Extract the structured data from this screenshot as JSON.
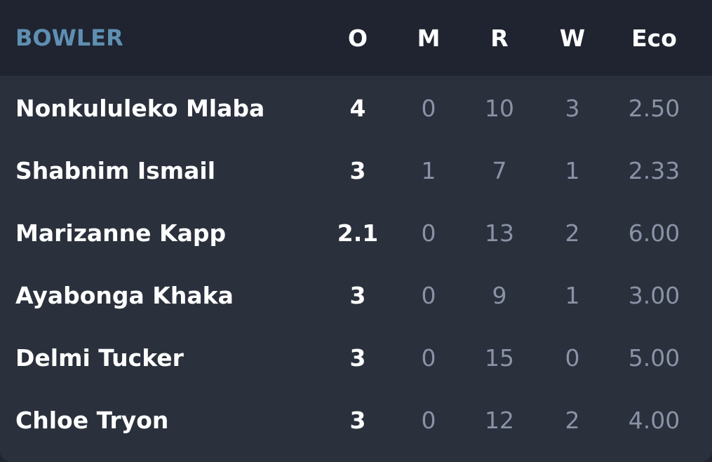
{
  "header": {
    "bowler": "BOWLER",
    "overs": "O",
    "maidens": "M",
    "runs": "R",
    "wickets": "W",
    "economy": "Eco"
  },
  "rows": [
    {
      "name": "Nonkululeko Mlaba",
      "o": "4",
      "m": "0",
      "r": "10",
      "w": "3",
      "eco": "2.50"
    },
    {
      "name": "Shabnim Ismail",
      "o": "3",
      "m": "1",
      "r": "7",
      "w": "1",
      "eco": "2.33"
    },
    {
      "name": "Marizanne Kapp",
      "o": "2.1",
      "m": "0",
      "r": "13",
      "w": "2",
      "eco": "6.00"
    },
    {
      "name": "Ayabonga Khaka",
      "o": "3",
      "m": "0",
      "r": "9",
      "w": "1",
      "eco": "3.00"
    },
    {
      "name": "Delmi Tucker",
      "o": "3",
      "m": "0",
      "r": "15",
      "w": "0",
      "eco": "5.00"
    },
    {
      "name": "Chloe Tryon",
      "o": "3",
      "m": "0",
      "r": "12",
      "w": "2",
      "eco": "4.00"
    }
  ],
  "colors": {
    "background": "#2a303c",
    "header_background": "#1f2430",
    "header_bowler_label": "#5f8fb2",
    "primary_text": "#ffffff",
    "secondary_text": "#8a93a6"
  }
}
